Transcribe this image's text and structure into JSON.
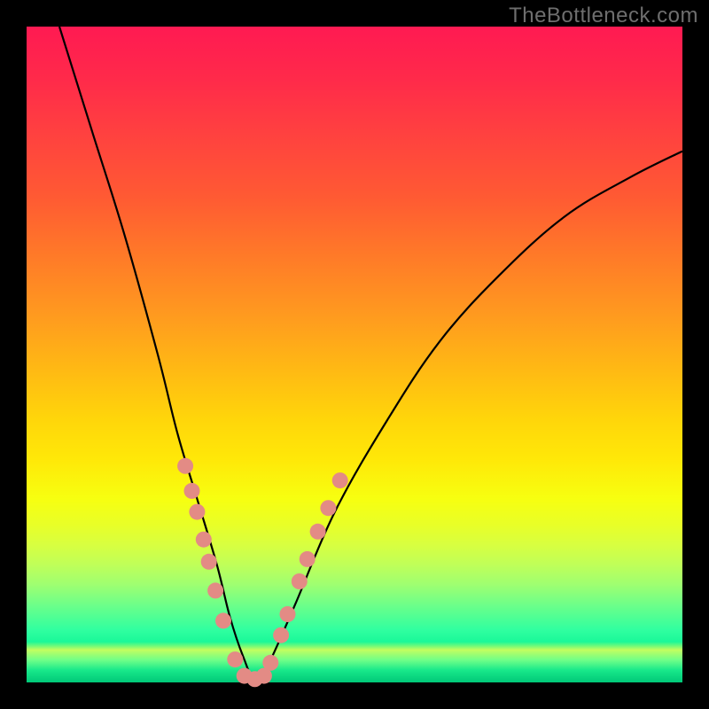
{
  "watermark": "TheBottleneck.com",
  "chart_data": {
    "type": "line",
    "title": "",
    "xlabel": "",
    "ylabel": "",
    "xlim": [
      0,
      1
    ],
    "ylim": [
      0,
      1
    ],
    "series": [
      {
        "name": "bottleneck-curve",
        "x": [
          0.05,
          0.1,
          0.15,
          0.2,
          0.23,
          0.26,
          0.29,
          0.31,
          0.33,
          0.35,
          0.37,
          0.41,
          0.47,
          0.55,
          0.63,
          0.72,
          0.82,
          0.92,
          1.0
        ],
        "y": [
          1.0,
          0.84,
          0.68,
          0.5,
          0.38,
          0.28,
          0.18,
          0.1,
          0.04,
          0.0,
          0.03,
          0.12,
          0.26,
          0.4,
          0.52,
          0.62,
          0.71,
          0.77,
          0.81
        ]
      }
    ],
    "markers": {
      "name": "highlight-dots",
      "color": "#e38b85",
      "points": [
        {
          "x": 0.242,
          "y": 0.33
        },
        {
          "x": 0.252,
          "y": 0.292
        },
        {
          "x": 0.26,
          "y": 0.26
        },
        {
          "x": 0.27,
          "y": 0.218
        },
        {
          "x": 0.278,
          "y": 0.184
        },
        {
          "x": 0.288,
          "y": 0.14
        },
        {
          "x": 0.3,
          "y": 0.094
        },
        {
          "x": 0.318,
          "y": 0.035
        },
        {
          "x": 0.332,
          "y": 0.01
        },
        {
          "x": 0.348,
          "y": 0.005
        },
        {
          "x": 0.362,
          "y": 0.01
        },
        {
          "x": 0.372,
          "y": 0.03
        },
        {
          "x": 0.388,
          "y": 0.072
        },
        {
          "x": 0.398,
          "y": 0.104
        },
        {
          "x": 0.416,
          "y": 0.154
        },
        {
          "x": 0.428,
          "y": 0.188
        },
        {
          "x": 0.444,
          "y": 0.23
        },
        {
          "x": 0.46,
          "y": 0.266
        },
        {
          "x": 0.478,
          "y": 0.308
        }
      ]
    },
    "background_gradient": {
      "top": "#ff1a52",
      "mid": "#ffd400",
      "bottom": "#00c878"
    }
  }
}
